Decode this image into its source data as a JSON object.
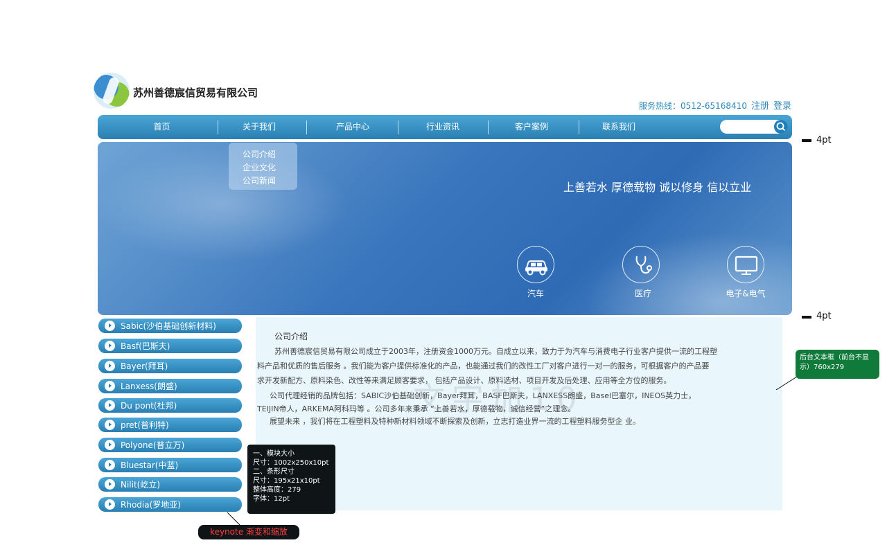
{
  "header": {
    "company_name": "苏州善德宸信贸易有限公司",
    "logo_icon": "swirl-logo-icon",
    "hotline": "服务热线：0512-65168410",
    "register": "注册",
    "login": "登录"
  },
  "nav": {
    "items": [
      "首页",
      "关于我们",
      "产品中心",
      "行业资讯",
      "客户案例",
      "联系我们"
    ],
    "search_placeholder": "",
    "search_icon": "magnifier-icon"
  },
  "dropdown": {
    "items": [
      "公司介绍",
      "企业文化",
      "公司新闻"
    ]
  },
  "banner": {
    "slogan": "上善若水 厚德载物 诚以修身 信以立业",
    "features": [
      {
        "label": "汽车",
        "icon": "car-icon"
      },
      {
        "label": "医疗",
        "icon": "stethoscope-icon"
      },
      {
        "label": "电子&电气",
        "icon": "monitor-icon"
      }
    ]
  },
  "sidebar": {
    "items": [
      "Sabic(沙伯基础创新材料)",
      "Basf(巴斯夫)",
      "Bayer(拜耳)",
      "Lanxess(朗盛)",
      "Du pont(杜邦)",
      "pret(普利特)",
      "Polyone(普立万)",
      "Bluestar(中蓝)",
      "Nilit(屹立)",
      "Rhodia(罗地亚)"
    ]
  },
  "content": {
    "title": "公司介绍",
    "para1_l1": "苏州善德宸信贸易有限公司成立于2003年，注册资金1000万元。自成立以来，致力于为汽车与消费电子行业客户提供一流的工程塑",
    "para1_l2": "料产品和优质的售后服务 。我们能为客户提供标准化的产品，也能通过我们的改性工厂对客户进行一对一的服务，可根据客户的产品要",
    "para1_l3": "求开发新配方、原料染色、改性等来满足顾客要求， 包括产品设计、原料选材、项目开发及后处理、应用等全方位的服务。",
    "para2_l1": "公司代理经销的品牌包括：SABIC沙伯基础创新，Bayer拜耳，BASF巴斯夫，LANXESS朗盛，Basel巴塞尔，INEOS英力士，",
    "para2_l2": "TEIJIN帝人，ARKEMA阿科玛等 。公司多年来秉承 “上善若水，厚德载物，诚信经营”之理念。",
    "para3": "展望未来 ，我们将在工程塑料及特种新材料领域不断探索及创新，立志打造业界一流的工程塑料服务型企 业。",
    "watermark": "文字加10"
  },
  "annotations": {
    "spec_lines": [
      "一、模块大小",
      "尺寸：1002x250x10pt",
      "二、条形尺寸",
      "尺寸：195x21x10pt",
      "整体高度：279",
      "字体：12pt"
    ],
    "keynote": "keynote 渐变和缩放",
    "text_box_note": "后台文本框（前台不显示）760x279",
    "dim_top": "4pt",
    "dim_bottom": "4pt"
  },
  "colors": {
    "nav_gradient_top": "#4aa6d6",
    "nav_gradient_bottom": "#2a7fb3",
    "content_bg": "#e9f6fc",
    "brand_text": "#2a85b8",
    "note_green": "#0f7a3a"
  }
}
